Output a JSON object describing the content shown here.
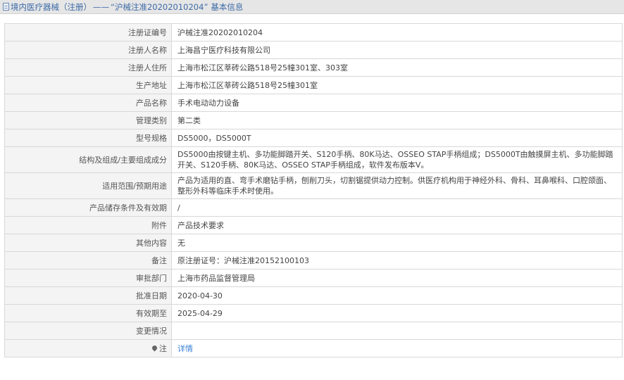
{
  "header": {
    "category": "境内医疗器械（注册）",
    "separator": "——",
    "reg_number_quoted": "“沪械注准20202010204”",
    "suffix": "基本信息"
  },
  "rows": [
    {
      "label": "注册证编号",
      "value": "沪械注准20202010204"
    },
    {
      "label": "注册人名称",
      "value": "上海昌宁医疗科技有限公司"
    },
    {
      "label": "注册人住所",
      "value": "上海市松江区莘砖公路518号25幢301室、303室"
    },
    {
      "label": "生产地址",
      "value": "上海市松江区莘砖公路518号25幢301室"
    },
    {
      "label": "产品名称",
      "value": "手术电动动力设备"
    },
    {
      "label": "管理类别",
      "value": "第二类"
    },
    {
      "label": "型号规格",
      "value": "DS5000，DS5000T"
    },
    {
      "label": "结构及组成/主要组成成分",
      "value": "DS5000由按键主机、多功能脚踏开关、S120手柄、80K马达、OSSEO STAP手柄组成；DS5000T由触摸屏主机、多功能脚踏开关、S120手柄、80K马达、OSSEO STAP手柄组成，软件发布版本V。"
    },
    {
      "label": "适用范围/预期用途",
      "value": "产品为适用的直、弯手术磨钻手柄，刨削刀头，切割锯提供动力控制。供医疗机构用于神经外科、骨科、耳鼻喉科、口腔颌面、整形外科等临床手术时使用。"
    },
    {
      "label": "产品储存条件及有效期",
      "value": "/"
    },
    {
      "label": "附件",
      "value": "产品技术要求"
    },
    {
      "label": "其他内容",
      "value": "无"
    },
    {
      "label": "备注",
      "value": "原注册证号：沪械注准20152100103"
    },
    {
      "label": "审批部门",
      "value": "上海市药品监督管理局"
    },
    {
      "label": "批准日期",
      "value": "2020-04-30"
    },
    {
      "label": "有效期至",
      "value": "2025-04-29"
    },
    {
      "label": "变更情况",
      "value": ""
    }
  ],
  "note_row": {
    "label": "注",
    "link_text": "详情",
    "icon": "map-pin-icon"
  },
  "colors": {
    "title": "#3d6aa7",
    "link": "#3b82d6",
    "label_bg": "#f4f4f4",
    "border": "#d8d8d8"
  }
}
